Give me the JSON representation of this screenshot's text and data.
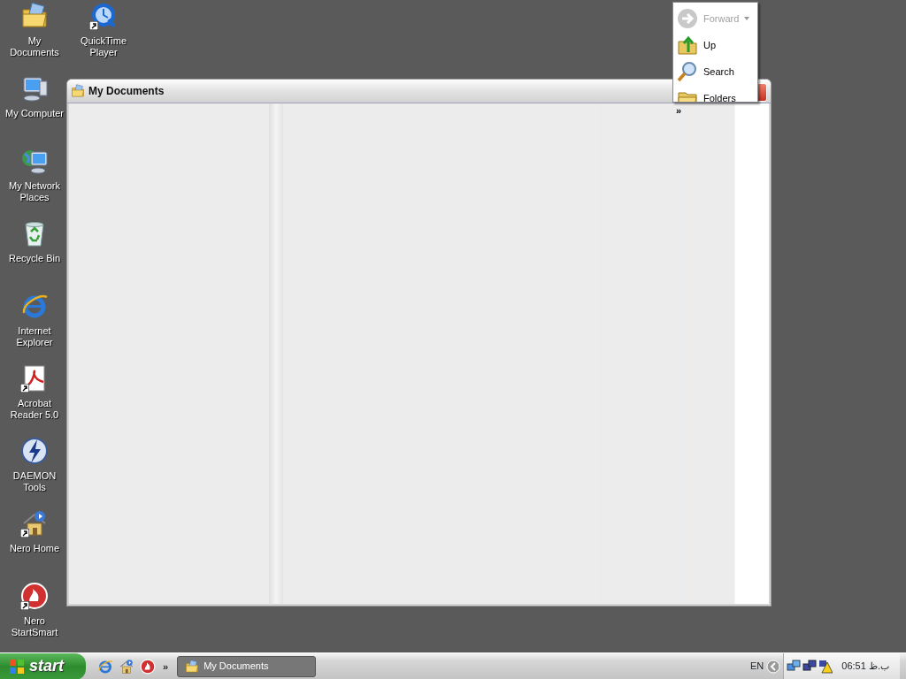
{
  "desktop_columns": [
    [
      {
        "label": "My Documents",
        "kind": "documents",
        "shortcut": false
      },
      {
        "label": "My Computer",
        "kind": "computer",
        "shortcut": false
      },
      {
        "label": "My Network Places",
        "kind": "network",
        "shortcut": false
      },
      {
        "label": "Recycle Bin",
        "kind": "recycle",
        "shortcut": false
      },
      {
        "label": "Internet Explorer",
        "kind": "browser",
        "shortcut": false
      },
      {
        "label": "Acrobat Reader 5.0",
        "kind": "pdf",
        "shortcut": true
      },
      {
        "label": "DAEMON Tools",
        "kind": "lightning",
        "shortcut": false
      },
      {
        "label": "Nero Home",
        "kind": "home",
        "shortcut": true
      },
      {
        "label": "Nero StartSmart",
        "kind": "flame",
        "shortcut": true
      }
    ],
    [
      {
        "label": "QuickTime Player",
        "kind": "player",
        "shortcut": true
      }
    ]
  ],
  "window": {
    "title": "My Documents",
    "toolbar_overflow": "»"
  },
  "toolbar_menu": {
    "items": [
      {
        "label": "Forward",
        "kind": "forward",
        "disabled": true,
        "dropdown": true
      },
      {
        "label": "Up",
        "kind": "up",
        "disabled": false,
        "dropdown": false
      },
      {
        "label": "Search",
        "kind": "search",
        "disabled": false,
        "dropdown": false
      },
      {
        "label": "Folders",
        "kind": "folders",
        "disabled": false,
        "dropdown": false
      }
    ]
  },
  "taskbar": {
    "start_label": "start",
    "quick_launch": [
      {
        "kind": "browser"
      },
      {
        "kind": "home"
      },
      {
        "kind": "flame"
      }
    ],
    "quick_launch_overflow": "»",
    "tasks": [
      {
        "label": "My Documents",
        "selected": true
      }
    ],
    "tray": {
      "language": "EN",
      "clock": "06:51 ب.ظ"
    }
  }
}
